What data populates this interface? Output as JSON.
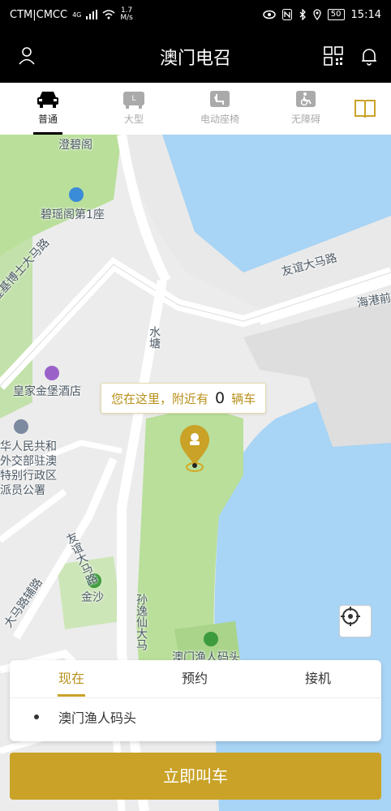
{
  "status_bar": {
    "carrier": "CTM|CMCC",
    "network": "4G",
    "speed": "1.7",
    "speed_unit": "M/s",
    "battery": "50",
    "time": "15:14"
  },
  "header": {
    "title": "澳门电召"
  },
  "tabs": [
    {
      "label": "普通",
      "icon": "car-icon",
      "active": true
    },
    {
      "label": "大型",
      "icon": "large-car-icon",
      "active": false
    },
    {
      "label": "电动座椅",
      "icon": "power-seat-icon",
      "active": false
    },
    {
      "label": "无障碍",
      "icon": "wheelchair-icon",
      "active": false
    }
  ],
  "map": {
    "labels": {
      "l1": "澄碧阁",
      "l2": "碧瑶阁第1座",
      "l3": "友谊大马路",
      "l4": "海港前",
      "l5": "罗理基博士大马路",
      "l6": "水塘",
      "l7": "皇家金堡酒店",
      "l8": "华人民共和",
      "l9": "外交部驻澳",
      "l10": "特别行政区",
      "l11": "派员公署",
      "l12": "友谊大马路",
      "l13": "金沙",
      "l14": "孙逸仙大马",
      "l15": "澳门渔人码头",
      "l16": "大马路辅路"
    },
    "bubble": {
      "prefix": "您在这里，附近有",
      "count": "0",
      "suffix": "辆车"
    }
  },
  "panel": {
    "tabs": [
      "现在",
      "预约",
      "接机"
    ],
    "destination": "澳门渔人码头"
  },
  "call_button": "立即叫车",
  "colors": {
    "accent": "#c9a227",
    "header": "#000000",
    "water": "#a8d4f5",
    "park": "#b9df9a"
  }
}
